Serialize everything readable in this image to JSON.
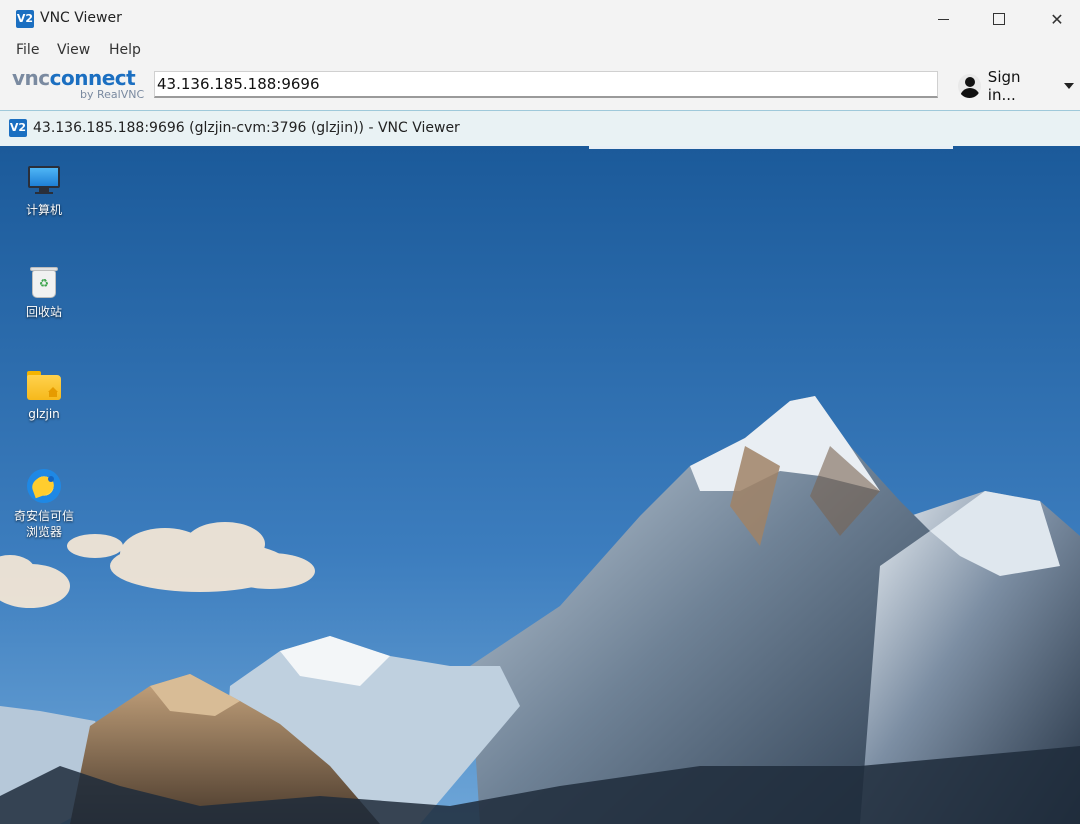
{
  "window": {
    "app_icon_text": "V2",
    "title": "VNC Viewer"
  },
  "menu": {
    "items": [
      "File",
      "View",
      "Help"
    ]
  },
  "toolbar": {
    "logo_vnc": "vnc",
    "logo_connect": "connect",
    "logo_sub": "by RealVNC",
    "address_value": "43.136.185.188:9696",
    "signin_label": "Sign in..."
  },
  "session": {
    "title": "43.136.185.188:9696 (glzjin-cvm:3796 (glzjin)) - VNC Viewer"
  },
  "desktop": {
    "icons": [
      {
        "label": "计算机",
        "icon": "computer-icon"
      },
      {
        "label": "回收站",
        "icon": "trash-icon"
      },
      {
        "label": "glzjin",
        "icon": "home-folder-icon"
      },
      {
        "label_line1": "奇安信可信",
        "label_line2": "浏览器",
        "icon": "browser-icon"
      }
    ]
  },
  "colors": {
    "sky_top": "#1c5c9c",
    "sky_bottom": "#4f8fcf",
    "accent": "#1b6fc1"
  }
}
